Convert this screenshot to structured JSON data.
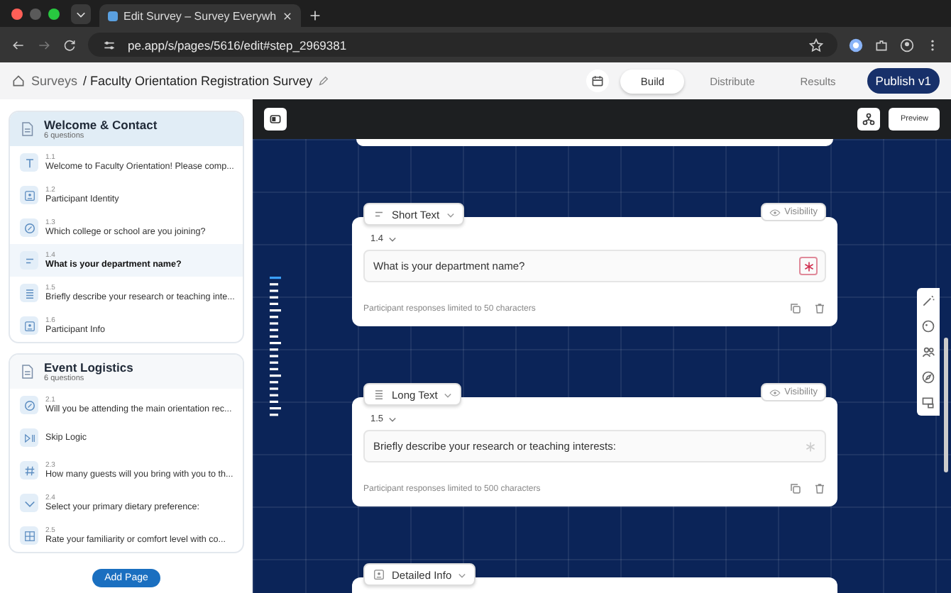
{
  "browser": {
    "tab_title": "Edit Survey – Survey Everywh",
    "url": "pe.app/s/pages/5616/edit#step_2969381"
  },
  "header": {
    "root": "Surveys",
    "title": "/ Faculty Orientation Registration Survey",
    "tabs": [
      {
        "label": "Build",
        "selected": true
      },
      {
        "label": "Distribute",
        "selected": false
      },
      {
        "label": "Results",
        "selected": false
      }
    ],
    "publish": "Publish v1"
  },
  "sidebar": {
    "pages": [
      {
        "title": "Welcome & Contact",
        "subtitle": "6 questions",
        "selected": true,
        "items": [
          {
            "kind": "text",
            "number": "1.1",
            "label": "Welcome to Faculty Orientation! Please comp...",
            "selected": false
          },
          {
            "kind": "id",
            "number": "1.2",
            "label": "Participant Identity",
            "selected": false
          },
          {
            "kind": "choice",
            "number": "1.3",
            "label": "Which college or school are you joining?",
            "selected": false
          },
          {
            "kind": "short",
            "number": "1.4",
            "label": "What is your department name?",
            "selected": true
          },
          {
            "kind": "long",
            "number": "1.5",
            "label": "Briefly describe your research or teaching inte...",
            "selected": false
          },
          {
            "kind": "id",
            "number": "1.6",
            "label": "Participant Info",
            "selected": false
          }
        ]
      },
      {
        "title": "Event Logistics",
        "subtitle": "6 questions",
        "selected": false,
        "items": [
          {
            "kind": "choice",
            "number": "2.1",
            "label": "Will you be attending the main orientation rec...",
            "selected": false
          },
          {
            "kind": "skip",
            "label": "Skip Logic",
            "selected": false
          },
          {
            "kind": "number",
            "number": "2.3",
            "label": "How many guests will you bring with you to th...",
            "selected": false
          },
          {
            "kind": "dropdown",
            "number": "2.4",
            "label": "Select your primary dietary preference:",
            "selected": false
          },
          {
            "kind": "matrix",
            "number": "2.5",
            "label": "Rate your familiarity or comfort level with co...",
            "selected": false
          }
        ]
      }
    ],
    "add_page": "Add Page"
  },
  "toolbar": {
    "preview": "Preview"
  },
  "cards": [
    {
      "kind": "short",
      "type_label": "Short Text",
      "visibility": "Visibility",
      "number": "1.4",
      "question": "What is your department name?",
      "required": true,
      "footer": "Participant responses limited to 50 characters"
    },
    {
      "kind": "long",
      "type_label": "Long Text",
      "visibility": "Visibility",
      "number": "1.5",
      "question": "Briefly describe your research or teaching interests:",
      "required": false,
      "footer": "Participant responses limited to 500 characters"
    },
    {
      "kind": "id",
      "type_label": "Detailed Info"
    }
  ]
}
